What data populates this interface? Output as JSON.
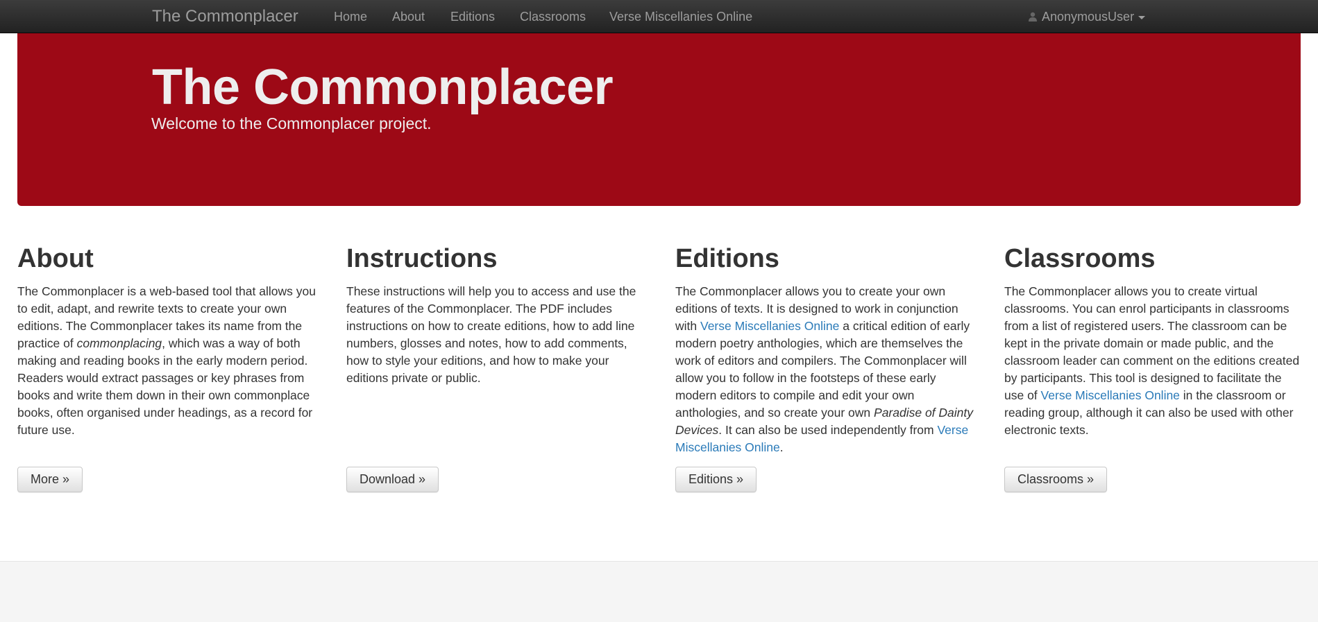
{
  "navbar": {
    "brand": "The Commonplacer",
    "links": [
      "Home",
      "About",
      "Editions",
      "Classrooms",
      "Verse Miscellanies Online"
    ],
    "user": {
      "icon": "user-icon",
      "name": "AnonymousUser",
      "dropdown_icon": "caret-down-icon"
    }
  },
  "jumbotron": {
    "title": "The Commonplacer",
    "subtitle": "Welcome to the Commonplacer project.",
    "background_color": "#9d0916"
  },
  "sections": {
    "about": {
      "heading": "About",
      "text_1": "The Commonplacer is a web-based tool that allows you to edit, adapt, and rewrite texts to create your own editions. The Commonplacer takes its name from the practice of ",
      "emphasis": "commonplacing",
      "text_2": ", which was a way of both making and reading books in the early modern period. Readers would extract passages or key phrases from books and write them down in their own commonplace books, often organised under headings, as a record for future use.",
      "button": "More »"
    },
    "instructions": {
      "heading": "Instructions",
      "text": "These instructions will help you to access and use the features of the Commonplacer. The PDF includes instructions on how to create editions, how to add line numbers, glosses and notes, how to add comments, how to style your editions, and how to make your editions private or public.",
      "button": "Download »"
    },
    "editions": {
      "heading": "Editions",
      "text_1": "The Commonplacer allows you to create your own editions of texts. It is designed to work in conjunction with ",
      "link_1": "Verse Miscellanies Online",
      "text_2": " a critical edition of early modern poetry anthologies, which are themselves the work of editors and compilers. The Commonplacer will allow you to follow in the footsteps of these early modern editors to compile and edit your own anthologies, and so create your own ",
      "emphasis": "Paradise of Dainty Devices",
      "text_3": ". It can also be used independently from ",
      "link_2": "Verse Miscellanies Online",
      "text_4": ".",
      "button": "Editions »"
    },
    "classrooms": {
      "heading": "Classrooms",
      "text_1": "The Commonplacer allows you to create virtual classrooms. You can enrol participants in classrooms from a list of registered users. The classroom can be kept in the private domain or made public, and the classroom leader can comment on the editions created by participants. This tool is designed to facilitate the use of ",
      "link": "Verse Miscellanies Online",
      "text_2": " in the classroom or reading group, although it can also be used with other electronic texts.",
      "button": "Classrooms »"
    }
  },
  "colors": {
    "navbar": "#222222",
    "nav_text": "#9d9d9d",
    "link": "#2a7ab8",
    "text": "#333333",
    "footer": "#f5f5f5"
  }
}
